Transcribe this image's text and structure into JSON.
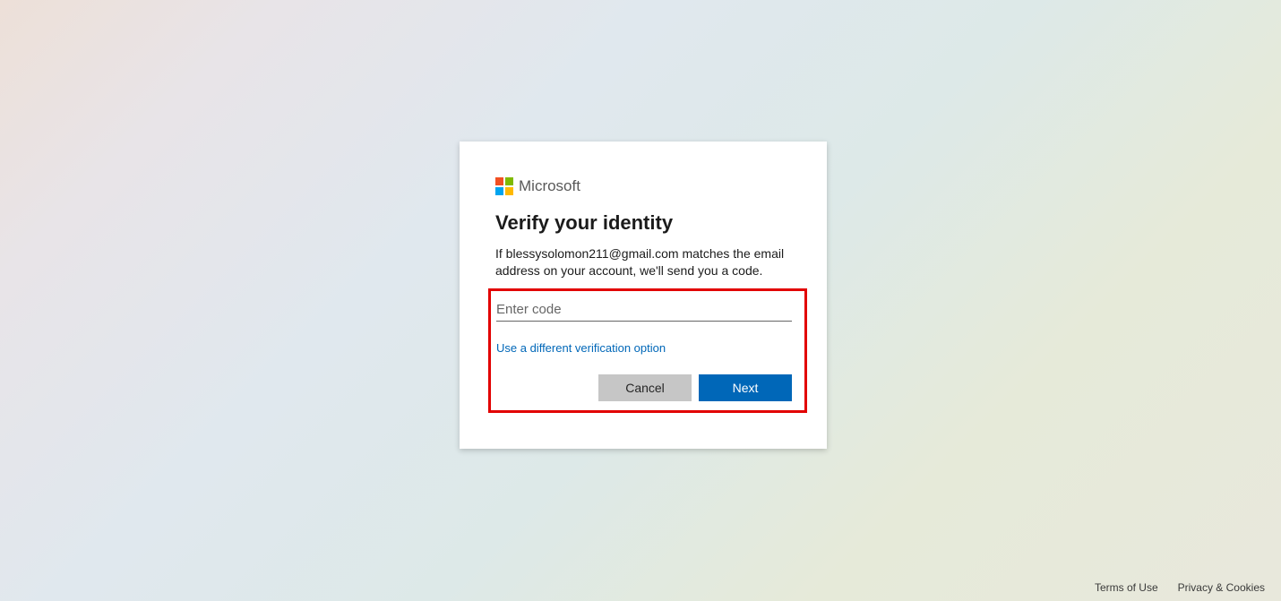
{
  "brand": {
    "name": "Microsoft"
  },
  "card": {
    "title": "Verify your identity",
    "description": "If blessysolomon211@gmail.com matches the email address on your account, we'll send you a code.",
    "code_placeholder": "Enter code",
    "alt_link": "Use a different verification option",
    "cancel_label": "Cancel",
    "next_label": "Next"
  },
  "footer": {
    "terms": "Terms of Use",
    "privacy": "Privacy & Cookies"
  }
}
